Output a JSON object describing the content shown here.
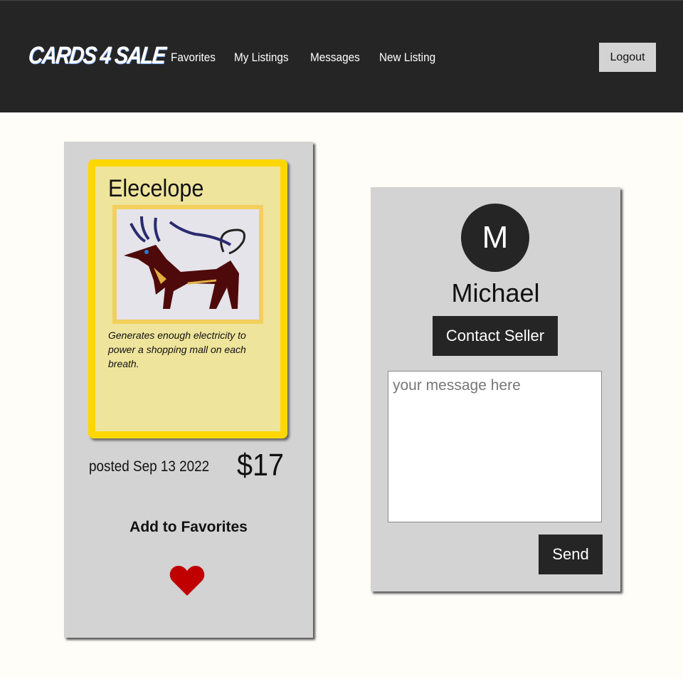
{
  "nav": {
    "logo": "CARDS 4 SALE",
    "links": [
      "Favorites",
      "My Listings",
      "Messages",
      "New Listing"
    ],
    "logout": "Logout"
  },
  "listing": {
    "card_name": "Elecelope",
    "description": "Generates enough electricity to power a shopping mall on each breath.",
    "posted": "posted Sep 13 2022",
    "price": "$17",
    "favorite_label": "Add to Favorites"
  },
  "seller": {
    "initial": "M",
    "name": "Michael",
    "contact_label": "Contact Seller",
    "message_placeholder": "your message here",
    "send_label": "Send"
  },
  "colors": {
    "nav": "#252525",
    "panel": "#d3d3d3",
    "card_border": "#ffd700",
    "heart": "#c00000"
  }
}
